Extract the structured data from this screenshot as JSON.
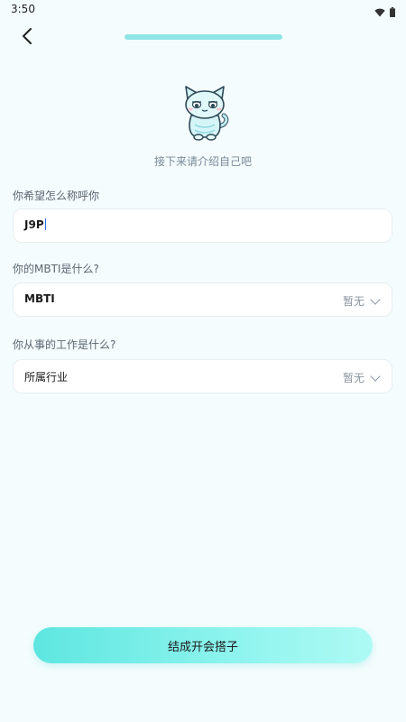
{
  "status_bar": {
    "time": "3:50",
    "icons": [
      "wifi-icon",
      "battery-icon"
    ]
  },
  "header": {
    "back_icon": "chevron-left-icon",
    "progress": 1.0
  },
  "intro": {
    "text": "接下来请介绍自己吧"
  },
  "form": {
    "name": {
      "label": "你希望怎么称呼你",
      "value": "J9P"
    },
    "mbti": {
      "label": "你的MBTI是什么?",
      "field_name": "MBTI",
      "value": "暂无"
    },
    "job": {
      "label": "你从事的工作是什么?",
      "field_name": "所属行业",
      "value": "暂无"
    }
  },
  "submit": {
    "label": "结成开会搭子"
  },
  "colors": {
    "background": "#f4fcfd",
    "accent": "#5ee6e0",
    "progress": "#8fe4e6",
    "caret": "#2a6cf0"
  }
}
